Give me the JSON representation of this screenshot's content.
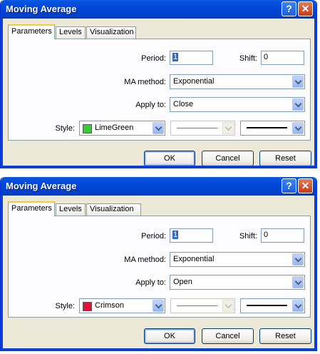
{
  "dialogs": [
    {
      "title": "Moving Average",
      "tabs": [
        "Parameters",
        "Levels",
        "Visualization"
      ],
      "period_label": "Period:",
      "period_value": "1",
      "shift_label": "Shift:",
      "shift_value": "0",
      "ma_method_label": "MA method:",
      "ma_method_value": "Exponential",
      "apply_to_label": "Apply to:",
      "apply_to_value": "Close",
      "style_label": "Style:",
      "style_color_name": "LimeGreen",
      "style_color_hex": "#32cd32",
      "ok_label": "OK",
      "cancel_label": "Cancel",
      "reset_label": "Reset"
    },
    {
      "title": "Moving Average",
      "tabs": [
        "Parameters",
        "Levels",
        "Visualization"
      ],
      "period_label": "Period:",
      "period_value": "1",
      "shift_label": "Shift:",
      "shift_value": "0",
      "ma_method_label": "MA method:",
      "ma_method_value": "Exponential",
      "apply_to_label": "Apply to:",
      "apply_to_value": "Open",
      "style_label": "Style:",
      "style_color_name": "Crimson",
      "style_color_hex": "#dc143c",
      "ok_label": "OK",
      "cancel_label": "Cancel",
      "reset_label": "Reset"
    }
  ],
  "icons": {
    "help": "help-icon",
    "close": "close-icon",
    "dropdown": "chevron-down-icon"
  },
  "colors": {
    "titlebar": "#0048d8",
    "dialog_bg": "#ece9d8",
    "active_tab_accent": "#ffc83c"
  }
}
